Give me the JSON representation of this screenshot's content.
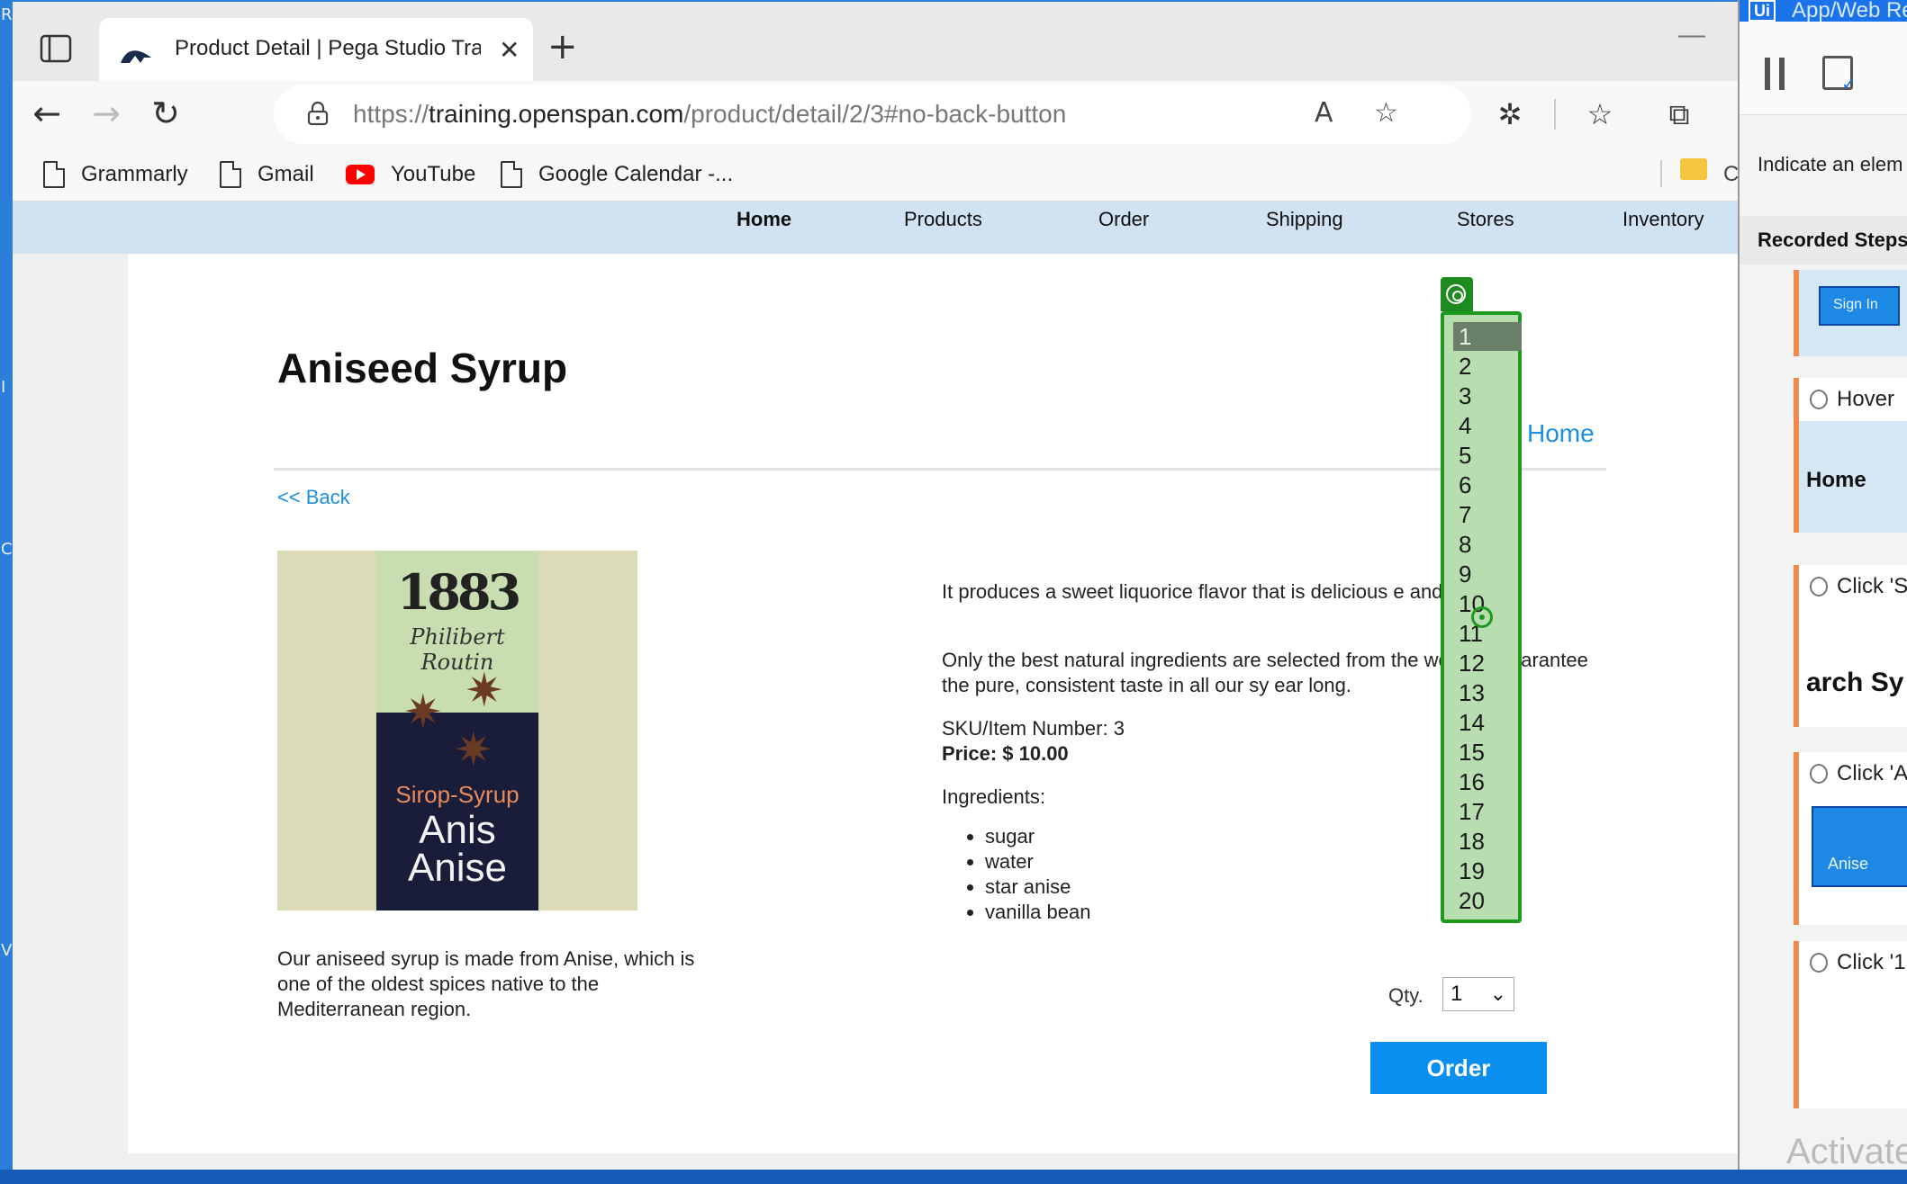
{
  "desktop": {
    "left_chars": [
      "R",
      "I",
      "C",
      "Vi"
    ]
  },
  "browser": {
    "tab": {
      "title": "Product Detail | Pega Studio Trai",
      "close": "✕"
    },
    "new_tab": "+",
    "minimize": "—",
    "nav": {
      "back": "←",
      "forward": "→",
      "reload": "↻"
    },
    "address": {
      "scheme": "https://",
      "host": "training.openspan.com",
      "path": "/product/detail/2/3#no-back-button"
    },
    "address_icons": {
      "read_aloud": "A",
      "favorite_add": "☆"
    },
    "toolbar_icons": {
      "extensions": "✲",
      "favorites": "☆",
      "collections": "⧉"
    },
    "bookmarks": [
      {
        "label": "Grammarly",
        "icon": "document-icon"
      },
      {
        "label": "Gmail",
        "icon": "document-icon"
      },
      {
        "label": "YouTube",
        "icon": "youtube-icon"
      },
      {
        "label": "Google Calendar -...",
        "icon": "document-icon"
      }
    ],
    "bookmarks_overflow_label": "C"
  },
  "site_nav": [
    "Home",
    "Products",
    "Order",
    "Shipping",
    "Stores",
    "Inventory"
  ],
  "product": {
    "title": "Aniseed Syrup",
    "home_link": "Home",
    "back_link": "<< Back",
    "image": {
      "brand_year": "1883",
      "script": "Philibert Routin",
      "sirop": "Sirop-Syrup",
      "anis": "Anis",
      "anise": "Anise"
    },
    "desc_left": "Our aniseed syrup is made from Anise, which is one of the oldest spices native to the Mediterranean region.",
    "desc_1": "It produces a sweet liquorice flavor that is delicious e and teas.",
    "desc_2": "Only the best natural ingredients are selected from the world to guarantee the pure, consistent taste in all our sy ear long.",
    "sku": "SKU/Item Number: 3",
    "price": "Price: $ 10.00",
    "ingredients_label": "Ingredients:",
    "ingredients": [
      "sugar",
      "water",
      "star anise",
      "vanilla bean"
    ],
    "qty_label": "Qty.",
    "qty_value": "1",
    "order_label": "Order"
  },
  "qty_options": [
    "1",
    "2",
    "3",
    "4",
    "5",
    "6",
    "7",
    "8",
    "9",
    "10",
    "11",
    "12",
    "13",
    "14",
    "15",
    "16",
    "17",
    "18",
    "19",
    "20"
  ],
  "qty_selected_index": 0,
  "recorder": {
    "title": "App/Web Re",
    "logo": "Ui",
    "indicate": "Indicate an elem",
    "steps_header": "Recorded Steps",
    "steps": [
      {
        "head": "",
        "thumb_text": "Sign In"
      },
      {
        "head": "Hover",
        "body_text": "Home"
      },
      {
        "head": "Click 'S",
        "body_text": "arch Sy"
      },
      {
        "head": "Click 'A",
        "thumb_text": "Anise"
      },
      {
        "head": "Click '1",
        "body_text": ""
      }
    ],
    "activate": "Activate"
  },
  "colors": {
    "accent": "#1a8fe3",
    "order_button": "#0a8ff0",
    "dropdown_fill": "#b8ddb0",
    "dropdown_border": "#1f9a1f",
    "step_border": "#f08a4b"
  }
}
